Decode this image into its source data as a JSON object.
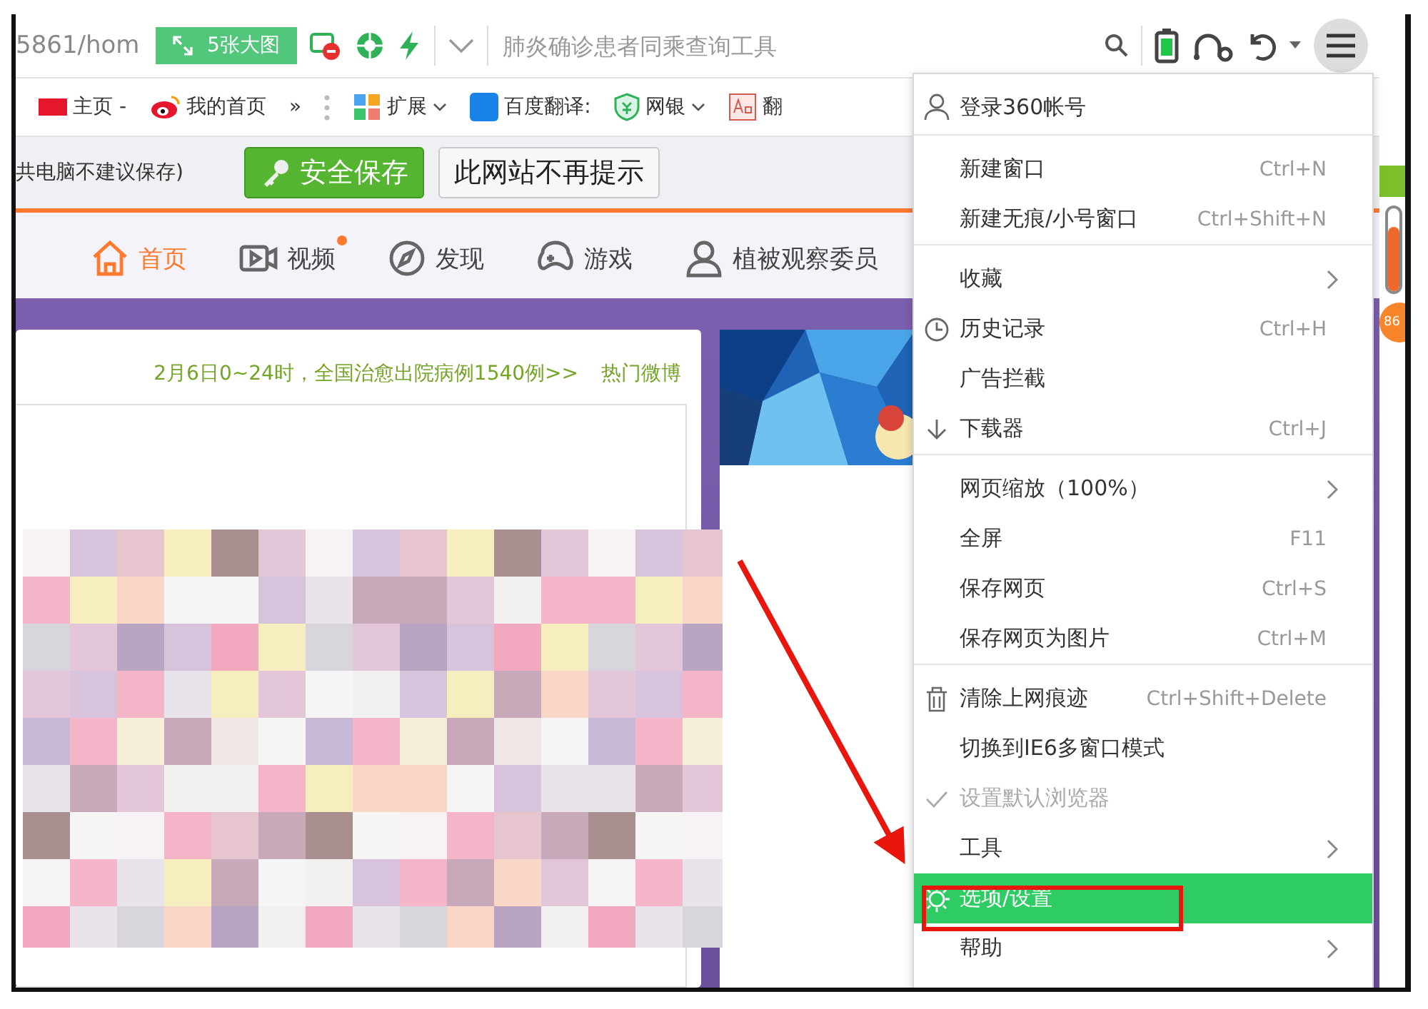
{
  "toolbar": {
    "address": "5861/hom",
    "big_image_button": "5张大图",
    "search": {
      "placeholder": "肺炎确诊患者同乘查询工具"
    }
  },
  "bookmarks": [
    {
      "label": "主页 -",
      "dropdown": false
    },
    {
      "label": "我的首页",
      "dropdown": false
    },
    {
      "label": "»",
      "dropdown": false
    },
    {
      "label": "扩展",
      "dropdown": true
    },
    {
      "label": "百度翻译:",
      "dropdown": false
    },
    {
      "label": "网银",
      "dropdown": true
    },
    {
      "label": "翻",
      "dropdown": false
    }
  ],
  "save_prompt": {
    "message": "共电脑不建议保存)",
    "buttons": [
      "安全保存",
      "此网站不再提示"
    ]
  },
  "nav": [
    {
      "label": "首页",
      "selected": true,
      "dot": false
    },
    {
      "label": "视频",
      "selected": false,
      "dot": true
    },
    {
      "label": "发现",
      "selected": false,
      "dot": false
    },
    {
      "label": "游戏",
      "selected": false,
      "dot": false
    },
    {
      "label": "植被观察委员",
      "selected": false,
      "dot": false
    }
  ],
  "feed": {
    "headline": "2月6日0~24时，全国治愈出院病例1540例>>",
    "link": "热门微博"
  },
  "side_widget": {
    "badge": "86"
  },
  "menu": {
    "items": [
      {
        "label": "登录360帐号",
        "selected": false,
        "disabled": false,
        "submenu": false,
        "separator_after": true
      },
      {
        "label": "新建窗口",
        "shortcut": "Ctrl+N",
        "selected": false,
        "disabled": false,
        "submenu": false,
        "separator_after": false
      },
      {
        "label": "新建无痕/小号窗口",
        "shortcut": "Ctrl+Shift+N",
        "selected": false,
        "disabled": false,
        "submenu": false,
        "separator_after": true
      },
      {
        "label": "收藏",
        "selected": false,
        "disabled": false,
        "submenu": true,
        "separator_after": false
      },
      {
        "label": "历史记录",
        "shortcut": "Ctrl+H",
        "selected": false,
        "disabled": false,
        "submenu": false,
        "separator_after": false
      },
      {
        "label": "广告拦截",
        "selected": false,
        "disabled": false,
        "submenu": false,
        "separator_after": false
      },
      {
        "label": "下载器",
        "shortcut": "Ctrl+J",
        "selected": false,
        "disabled": false,
        "submenu": false,
        "separator_after": true
      },
      {
        "label": "网页缩放（100%）",
        "selected": false,
        "disabled": false,
        "submenu": true,
        "separator_after": false
      },
      {
        "label": "全屏",
        "shortcut": "F11",
        "selected": false,
        "disabled": false,
        "submenu": false,
        "separator_after": false
      },
      {
        "label": "保存网页",
        "shortcut": "Ctrl+S",
        "selected": false,
        "disabled": false,
        "submenu": false,
        "separator_after": false
      },
      {
        "label": "保存网页为图片",
        "shortcut": "Ctrl+M",
        "selected": false,
        "disabled": false,
        "submenu": false,
        "separator_after": true
      },
      {
        "label": "清除上网痕迹",
        "shortcut": "Ctrl+Shift+Delete",
        "selected": false,
        "disabled": false,
        "submenu": false,
        "separator_after": false
      },
      {
        "label": "切换到IE6多窗口模式",
        "selected": false,
        "disabled": false,
        "submenu": false,
        "separator_after": false
      },
      {
        "label": "设置默认浏览器",
        "selected": false,
        "disabled": true,
        "submenu": false,
        "separator_after": false
      },
      {
        "label": "工具",
        "selected": false,
        "disabled": false,
        "submenu": true,
        "separator_after": false
      },
      {
        "label": "选项/设置",
        "selected": true,
        "disabled": false,
        "submenu": false,
        "separator_after": false
      },
      {
        "label": "帮助",
        "selected": false,
        "disabled": false,
        "submenu": true,
        "separator_after": false
      }
    ]
  }
}
